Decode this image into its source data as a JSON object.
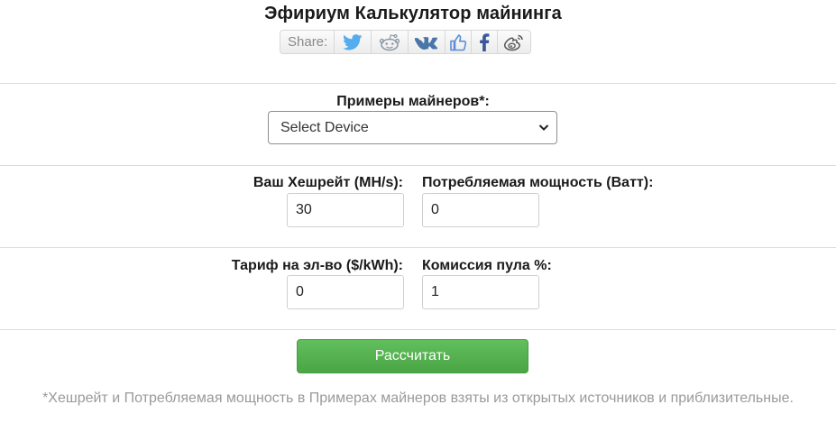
{
  "page": {
    "title": "Эфириум Калькулятор майнинга"
  },
  "share": {
    "label": "Share:",
    "buttons": [
      {
        "icon": "twitter-icon",
        "color": "#55acee"
      },
      {
        "icon": "reddit-icon",
        "color": "#8e9aa6"
      },
      {
        "icon": "vk-icon",
        "color": "#4a76a8"
      },
      {
        "icon": "like-icon",
        "color": "#5a8dd6"
      },
      {
        "icon": "facebook-icon",
        "color": "#3b5998"
      },
      {
        "icon": "weibo-icon",
        "color": "#6b6b6b"
      }
    ]
  },
  "device": {
    "label": "Примеры майнеров*:",
    "selected": "Select Device"
  },
  "hashrate": {
    "label": "Ваш Хешрейт (MH/s):",
    "value": "30"
  },
  "power": {
    "label": "Потребляемая мощность (Ватт):",
    "value": "0"
  },
  "tariff": {
    "label": "Тариф на эл-во ($/kWh):",
    "value": "0"
  },
  "pool_fee": {
    "label": "Комиссия пула %:",
    "value": "1"
  },
  "calculate": {
    "label": "Рассчитать",
    "color": "#56b151"
  },
  "footnote": "*Хешрейт и Потребляемая мощность в Примерах майнеров взяты из открытых источников и приблизительные."
}
